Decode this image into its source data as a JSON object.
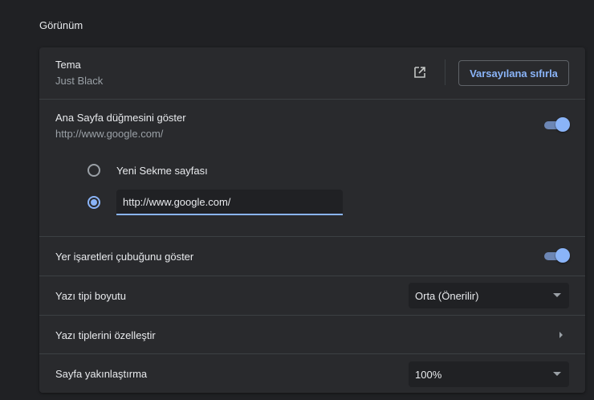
{
  "section": {
    "title": "Görünüm"
  },
  "theme": {
    "label": "Tema",
    "value": "Just Black",
    "reset_button": "Varsayılana sıfırla",
    "icon": "open-in-new-icon"
  },
  "home_button": {
    "label": "Ana Sayfa düğmesini göster",
    "value": "http://www.google.com/",
    "enabled": true,
    "options": [
      {
        "label": "Yeni Sekme sayfası",
        "checked": false
      },
      {
        "label": "",
        "checked": true
      }
    ],
    "custom_url": "http://www.google.com/"
  },
  "bookmarks_bar": {
    "label": "Yer işaretleri çubuğunu göster",
    "enabled": true
  },
  "font_size": {
    "label": "Yazı tipi boyutu",
    "selected": "Orta (Önerilir)"
  },
  "customize_fonts": {
    "label": "Yazı tiplerini özelleştir"
  },
  "page_zoom": {
    "label": "Sayfa yakınlaştırma",
    "selected": "100%"
  },
  "colors": {
    "accent": "#8ab4f8",
    "background": "#202124",
    "card": "#292a2d"
  }
}
